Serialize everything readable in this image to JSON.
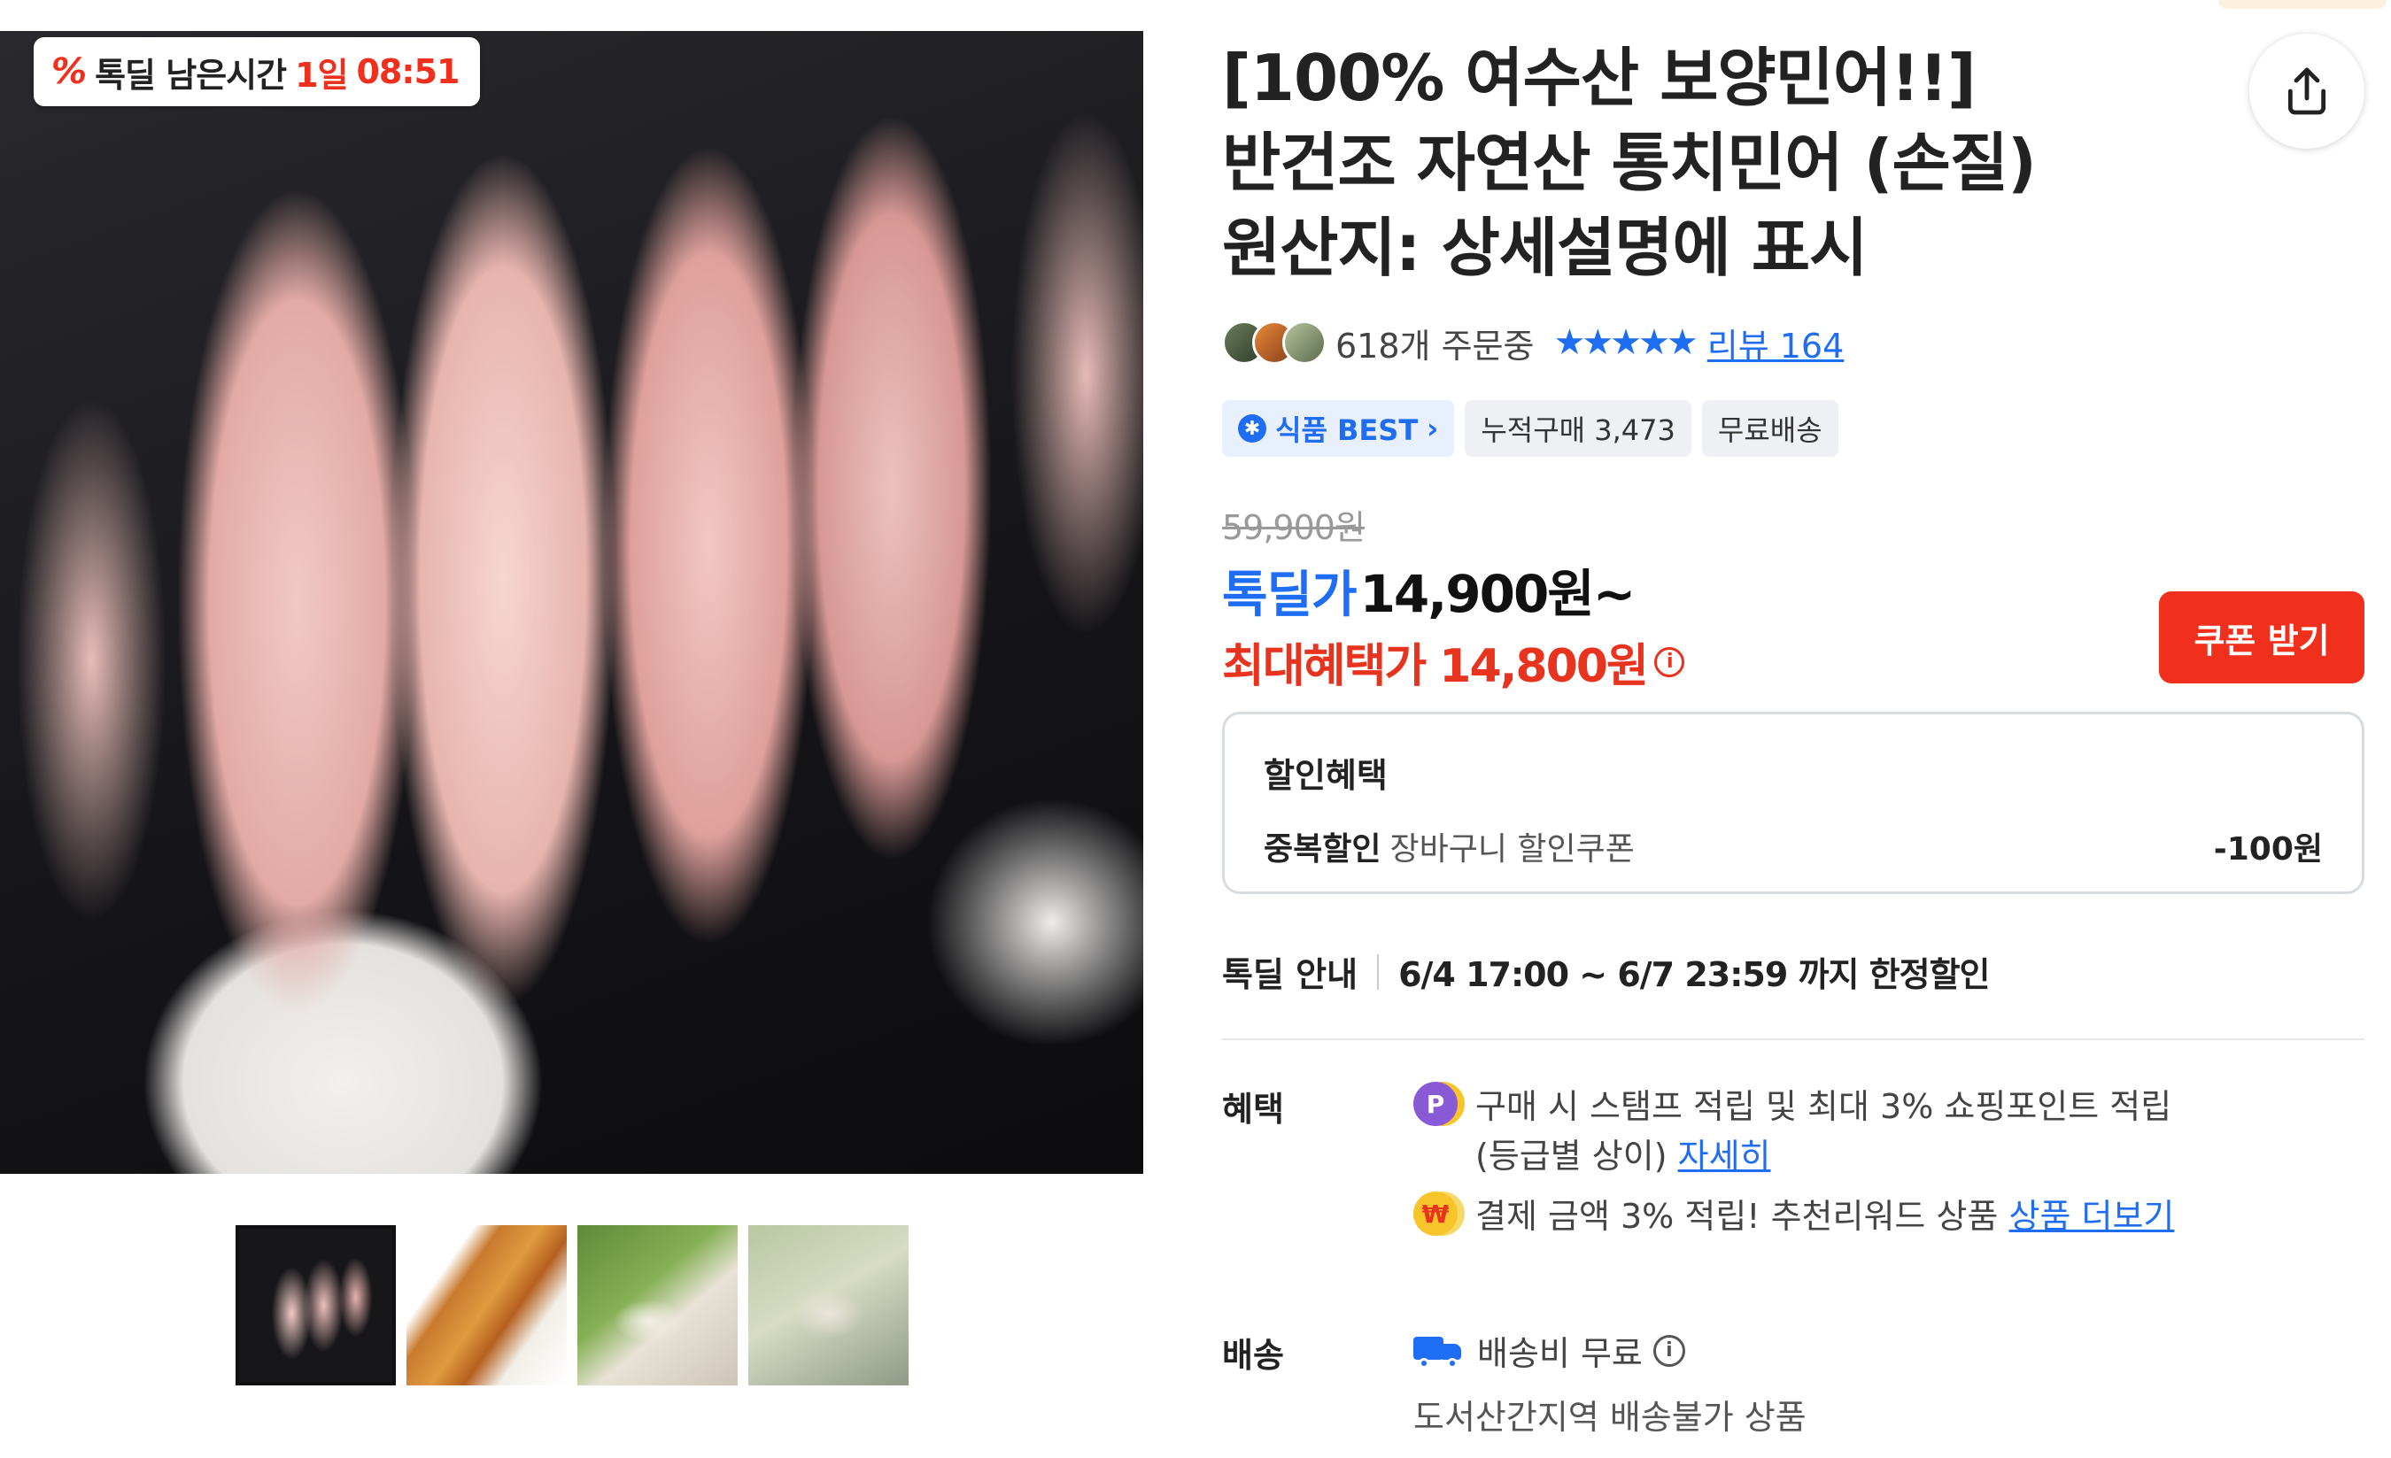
{
  "deal_timer": {
    "icon": "percent-deal-icon",
    "label": "톡딜 남은시간",
    "days": "1일",
    "clock": "08:51"
  },
  "product": {
    "title_lines": [
      "[100% 여수산 보양민어!!]",
      "반건조 자연산 통치민어 (손질)",
      "원산지: 상세설명에 표시"
    ],
    "order_count": "618개 주문중",
    "stars": "★★★★★",
    "review_link": "리뷰 164",
    "badges": {
      "best": "식품 BEST",
      "cumulative": "누적구매 3,473",
      "free_shipping": "무료배송"
    },
    "original_price": "59,900원",
    "deal_label": "톡딜가",
    "deal_price": "14,900원~",
    "max_benefit_price": "최대혜택가 14,800원",
    "coupon_button": "쿠폰 받기"
  },
  "discount": {
    "title": "할인혜택",
    "tag": "중복할인",
    "desc": "장바구니 할인쿠폰",
    "amount": "-100원"
  },
  "deal_notice": {
    "label": "톡딜 안내",
    "period": "6/4 17:00 ~ 6/7 23:59 까지 한정할인"
  },
  "benefits": {
    "label": "혜택",
    "row1_text": "구매 시 스탬프 적립 및 최대 3% 쇼핑포인트 적립",
    "row1_text2": "(등급별 상이)",
    "row1_link": "자세히",
    "row2_text": "결제 금액 3% 적립! 추천리워드 상품",
    "row2_link": "상품 더보기"
  },
  "shipping": {
    "label": "배송",
    "fee": "배송비 무료",
    "note": "도서산간지역 배송불가 상품"
  },
  "colors": {
    "accent_blue": "#1f6df2",
    "deal_red": "#f0301c",
    "benefit_red": "#e8331f"
  }
}
